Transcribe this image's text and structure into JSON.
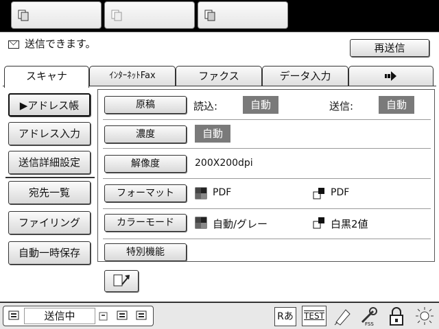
{
  "status": {
    "message": "送信できます。",
    "resend_label": "再送信"
  },
  "tabs": [
    "スキャナ",
    "ｲﾝﾀｰﾈｯﾄFax",
    "ファクス",
    "データ入力"
  ],
  "side": [
    "▶アドレス帳",
    "アドレス入力",
    "送信詳細設定",
    "宛先一覧",
    "ファイリング",
    "自動一時保存"
  ],
  "settings": {
    "original_label": "原稿",
    "read_label": "読込:",
    "read_value": "自動",
    "send_label": "送信:",
    "send_value": "自動",
    "density_label": "濃度",
    "density_value": "自動",
    "resolution_label": "解像度",
    "resolution_value": "200X200dpi",
    "format_label": "フォーマット",
    "format_color": "PDF",
    "format_bw": "PDF",
    "color_mode_label": "カラーモード",
    "color_mode_color": "自動/グレー",
    "color_mode_bw": "白黒2値",
    "special_label": "特別機能"
  },
  "bottom": {
    "job_status": "送信中",
    "r_label": "Rあ",
    "test_label": "TEST"
  },
  "colors": {
    "accent_gray": "#7a7a7a"
  }
}
